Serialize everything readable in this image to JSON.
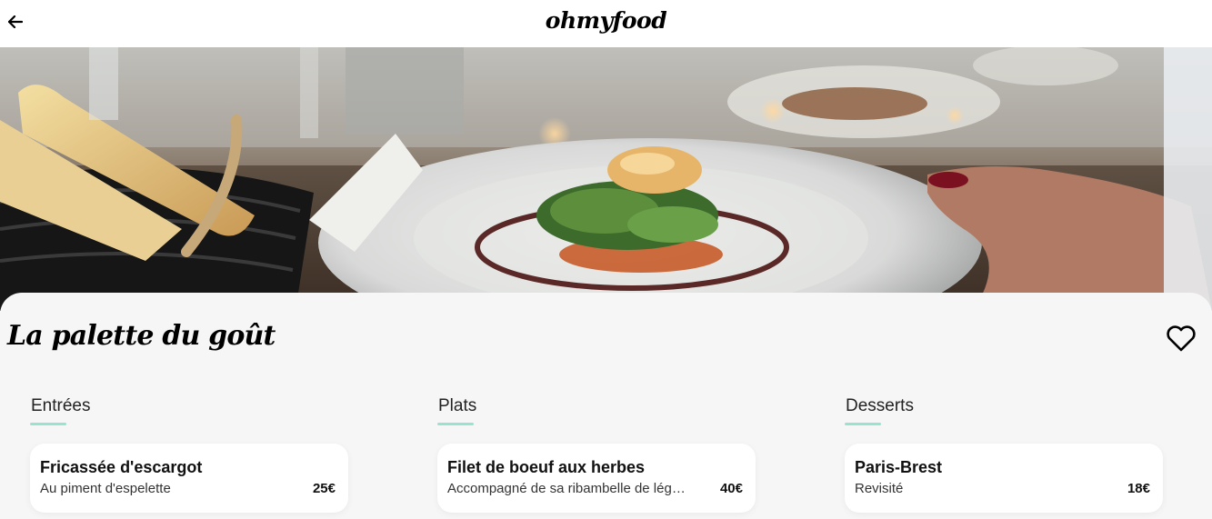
{
  "header": {
    "logo": "ohmyfood",
    "back_icon": "arrow-left-icon"
  },
  "hero": {
    "image_description": "plated-dish-photo"
  },
  "restaurant": {
    "name": "La palette du goût",
    "favorite_icon": "heart-outline-icon"
  },
  "menu": {
    "columns": [
      {
        "heading": "Entrées",
        "dish": {
          "name": "Fricassée d'escargot",
          "description": "Au piment d'espelette",
          "price": "25€"
        }
      },
      {
        "heading": "Plats",
        "dish": {
          "name": "Filet de boeuf aux herbes",
          "description": "Accompagné de sa ribambelle de légumes",
          "price": "40€"
        }
      },
      {
        "heading": "Desserts",
        "dish": {
          "name": "Paris-Brest",
          "description": "Revisité",
          "price": "18€"
        }
      }
    ]
  },
  "colors": {
    "accent": "#99e2d0",
    "background": "#f6f6f6",
    "card": "#ffffff"
  }
}
